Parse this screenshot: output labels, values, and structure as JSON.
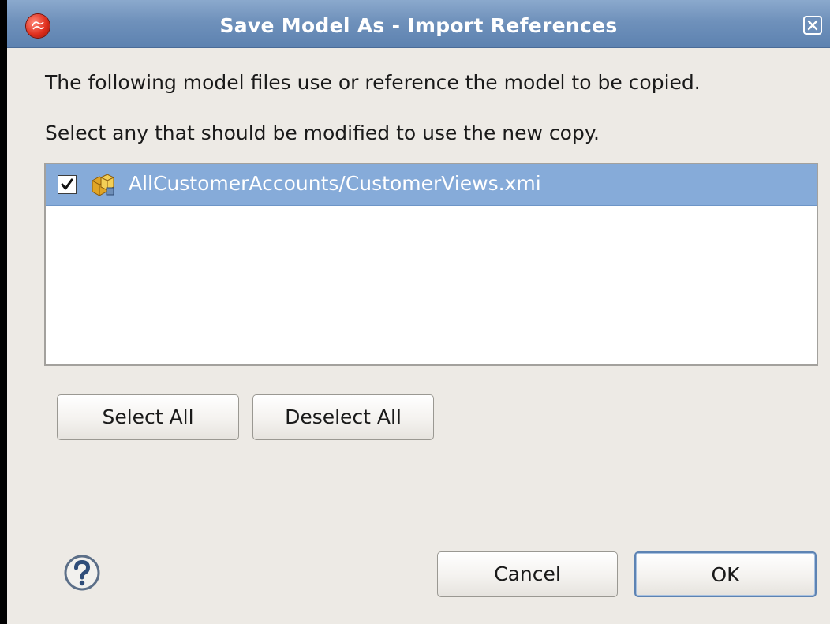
{
  "window": {
    "title": "Save Model As - Import References",
    "icons": {
      "app": "eclipse-app-icon",
      "close": "close-icon"
    }
  },
  "main": {
    "line1": "The following model files use or reference the model to be copied.",
    "line2": "Select any that should be modified to use the new copy.",
    "list": {
      "items": [
        {
          "label": "AllCustomerAccounts/CustomerViews.xmi",
          "checked": true,
          "selected": true,
          "icon": "view-model-icon"
        }
      ]
    },
    "buttons": {
      "select_all": "Select All",
      "deselect_all": "Deselect All"
    }
  },
  "footer": {
    "help_icon": "help-icon",
    "cancel": "Cancel",
    "ok": "OK"
  },
  "colors": {
    "titlebar": "#6f91bb",
    "selection": "#86abd9",
    "dialog_bg": "#edeae5",
    "default_button_border": "#5d83b3"
  }
}
